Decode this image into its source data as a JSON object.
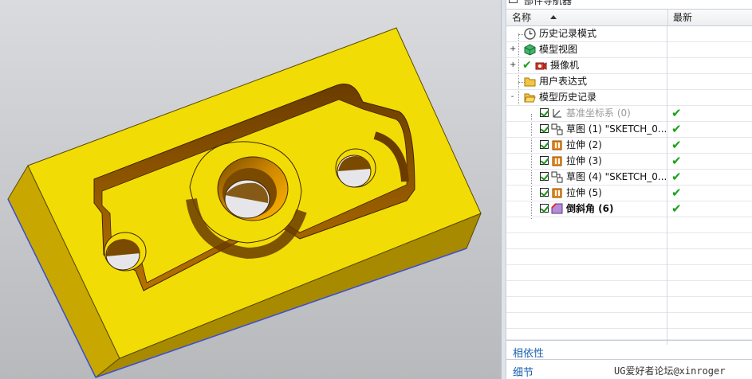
{
  "navigator": {
    "title": "部件导航器",
    "columns": {
      "name": "名称",
      "latest": "最新"
    },
    "nodes": [
      {
        "label": "历史记录模式",
        "icon": "clock-icon"
      },
      {
        "label": "模型视图",
        "icon": "model-view-icon",
        "expander": "+"
      },
      {
        "label": "摄像机",
        "icon": "camera-icon",
        "expander": "+"
      },
      {
        "label": "用户表达式",
        "icon": "folder-icon"
      },
      {
        "label": "模型历史记录",
        "icon": "folder-open-icon",
        "expander": "-"
      },
      {
        "label": "基准坐标系 (0)",
        "icon": "datum-csys-icon",
        "status": "✔"
      },
      {
        "label": "草图 (1) \"SKETCH_0...",
        "icon": "sketch-icon",
        "status": "✔"
      },
      {
        "label": "拉伸 (2)",
        "icon": "extrude-icon",
        "status": "✔"
      },
      {
        "label": "拉伸 (3)",
        "icon": "extrude-icon",
        "status": "✔"
      },
      {
        "label": "草图 (4) \"SKETCH_0...",
        "icon": "sketch-icon",
        "status": "✔"
      },
      {
        "label": "拉伸 (5)",
        "icon": "extrude-icon",
        "status": "✔"
      },
      {
        "label": "倒斜角 (6)",
        "icon": "chamfer-icon",
        "status": "✔"
      }
    ]
  },
  "dependencies_label": "相依性",
  "details_label": "细节",
  "watermark": "UG爱好者论坛@xinroger",
  "colors": {
    "part_face": "#f2dc05",
    "part_side": "#b89a00",
    "part_shadow": "#8a5a00",
    "check_green": "#19a119",
    "section_blue": "#1a5fb0"
  }
}
